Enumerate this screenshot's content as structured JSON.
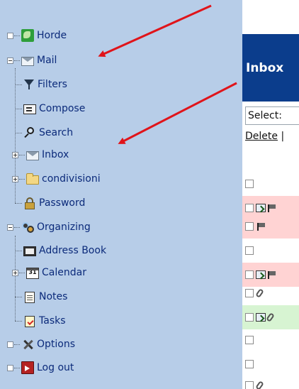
{
  "sidebar": {
    "items": [
      {
        "key": "horde",
        "label": "Horde"
      },
      {
        "key": "mail",
        "label": "Mail"
      },
      {
        "key": "filters",
        "label": "Filters"
      },
      {
        "key": "compose",
        "label": "Compose"
      },
      {
        "key": "search",
        "label": "Search"
      },
      {
        "key": "inbox",
        "label": "Inbox"
      },
      {
        "key": "condivisioni",
        "label": "condivisioni"
      },
      {
        "key": "password",
        "label": "Password"
      },
      {
        "key": "organizing",
        "label": "Organizing"
      },
      {
        "key": "address_book",
        "label": "Address Book"
      },
      {
        "key": "calendar",
        "label": "Calendar"
      },
      {
        "key": "notes",
        "label": "Notes"
      },
      {
        "key": "tasks",
        "label": "Tasks"
      },
      {
        "key": "options",
        "label": "Options"
      },
      {
        "key": "logout",
        "label": "Log out"
      }
    ],
    "calendar_icon_text": "31"
  },
  "right_panel": {
    "header_title": "Inbox",
    "select_label": "Select:",
    "delete_label": "Delete",
    "delete_separator": "|"
  },
  "colors": {
    "sidebar_bg": "#b7cde8",
    "header_bg": "#0b3d8c",
    "row_pink": "#ffd3d3",
    "row_green": "#d7f4d2",
    "annotation_arrow": "#e0141a",
    "tree_text": "#0b2a7a"
  }
}
